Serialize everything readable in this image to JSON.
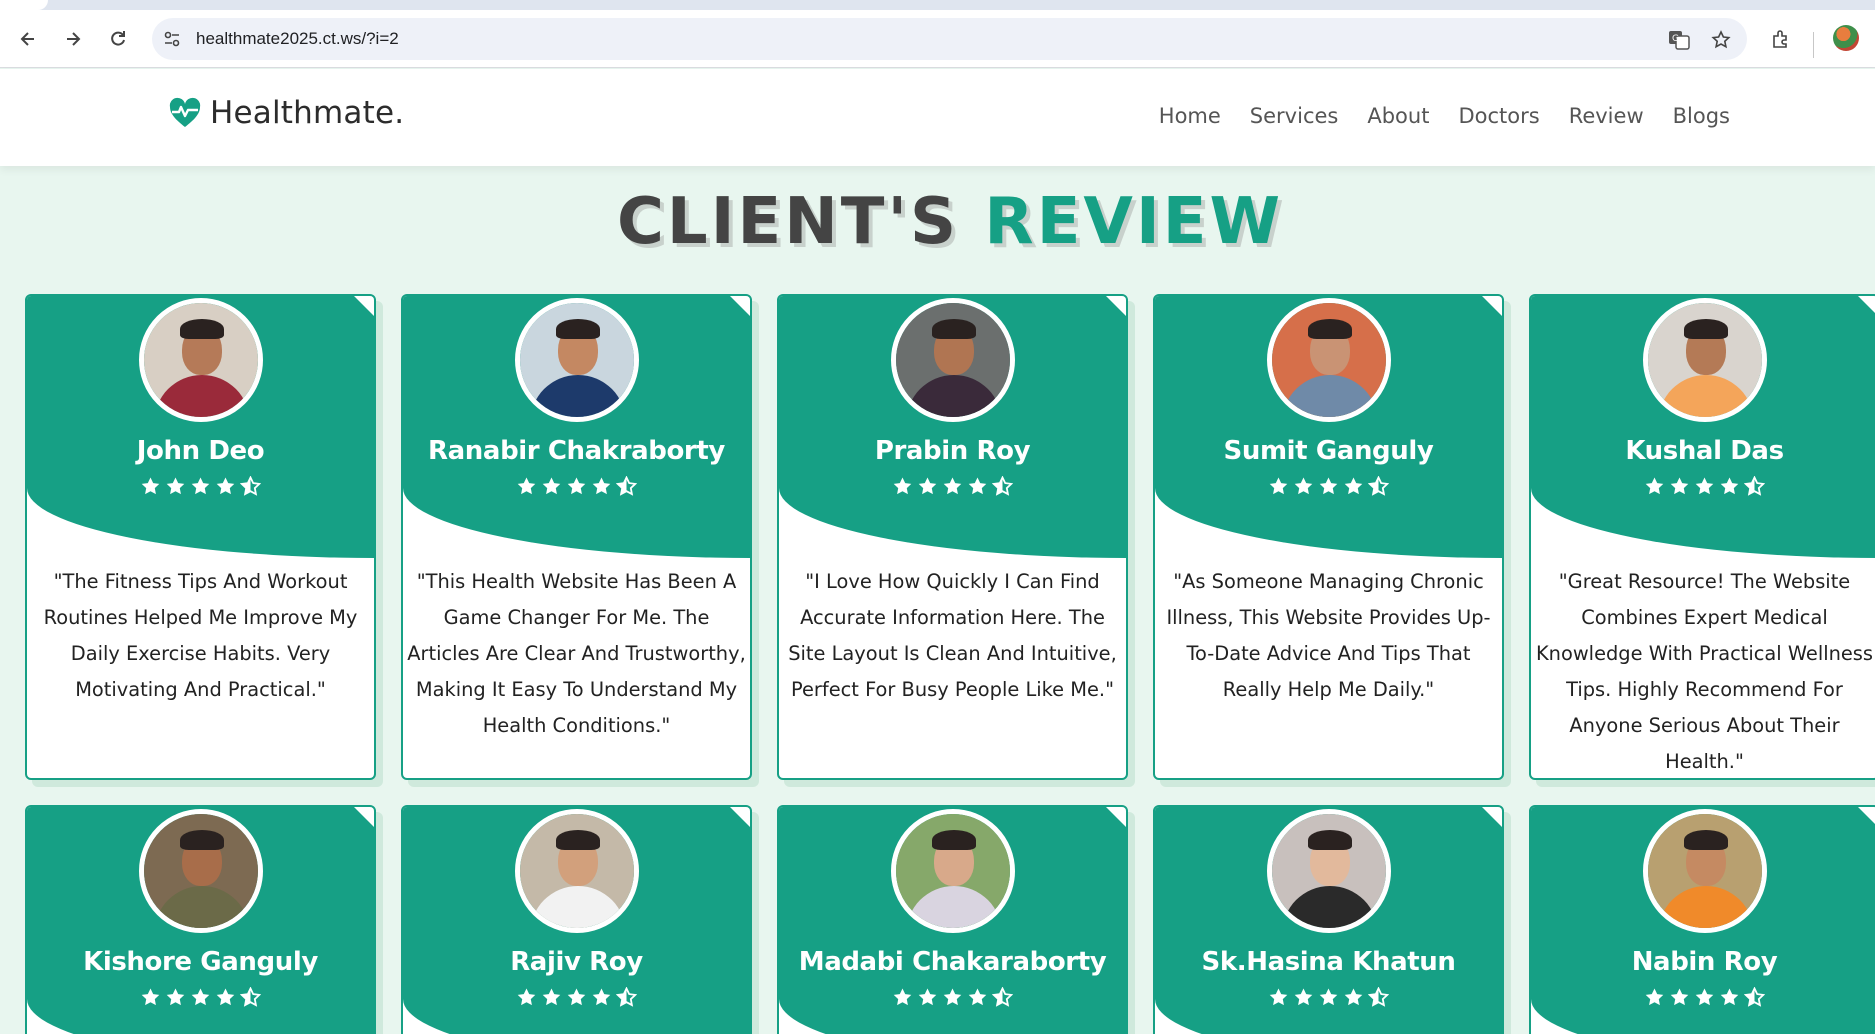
{
  "browser": {
    "url": "healthmate2025.ct.ws/?i=2"
  },
  "header": {
    "logo_text": "Healthmate.",
    "nav": [
      "Home",
      "Services",
      "About",
      "Doctors",
      "Review",
      "Blogs"
    ]
  },
  "section": {
    "title_part1": "CLIENT'S",
    "title_part2": "REVIEW"
  },
  "colors": {
    "accent": "#16a085",
    "background": "#e8f6ef",
    "title_dark": "#444444"
  },
  "rating_icons": [
    "star-icon",
    "star-icon",
    "star-icon",
    "star-icon",
    "star-half-icon"
  ],
  "reviews": [
    {
      "name": "John Deo",
      "rating": 4.5,
      "text": "\"The Fitness Tips And Workout Routines Helped Me Improve My Daily Exercise Habits. Very Motivating And Practical.\""
    },
    {
      "name": "Ranabir Chakraborty",
      "rating": 4.5,
      "text": "\"This Health Website Has Been A Game Changer For Me. The Articles Are Clear And Trustworthy, Making It Easy To Understand My Health Conditions.\""
    },
    {
      "name": "Prabin Roy",
      "rating": 4.5,
      "text": "\"I Love How Quickly I Can Find Accurate Information Here. The Site Layout Is Clean And Intuitive, Perfect For Busy People Like Me.\""
    },
    {
      "name": "Sumit Ganguly",
      "rating": 4.5,
      "text": "\"As Someone Managing Chronic Illness, This Website Provides Up-To-Date Advice And Tips That Really Help Me Daily.\""
    },
    {
      "name": "Kushal Das",
      "rating": 4.5,
      "text": "\"Great Resource! The Website Combines Expert Medical Knowledge With Practical Wellness Tips. Highly Recommend For Anyone Serious About Their Health.\""
    },
    {
      "name": "Kishore Ganguly",
      "rating": 4.5,
      "text": ""
    },
    {
      "name": "Rajiv Roy",
      "rating": 4.5,
      "text": ""
    },
    {
      "name": "Madabi Chakaraborty",
      "rating": 4.5,
      "text": ""
    },
    {
      "name": "Sk.Hasina Khatun",
      "rating": 4.5,
      "text": ""
    },
    {
      "name": "Nabin Roy",
      "rating": 4.5,
      "text": ""
    }
  ]
}
